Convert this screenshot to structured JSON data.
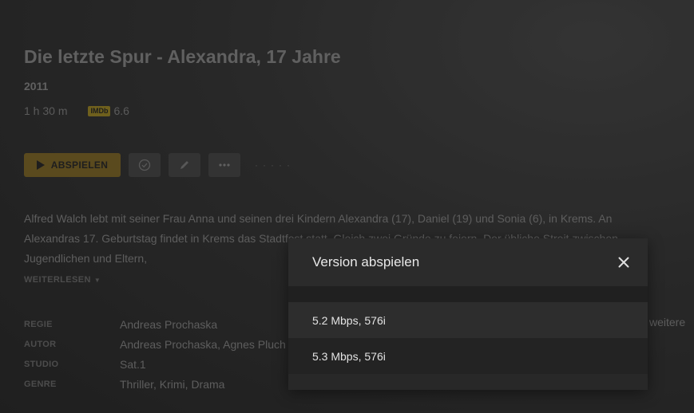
{
  "movie": {
    "title": "Die letzte Spur - Alexandra, 17 Jahre",
    "year": "2011",
    "duration": "1 h 30 m",
    "imdb_label": "IMDb",
    "imdb_rating": "6.6"
  },
  "actions": {
    "play_label": "ABSPIELEN",
    "watched_icon": "check-circle-icon",
    "edit_icon": "pencil-icon",
    "more_icon": "ellipsis-icon"
  },
  "description": {
    "text": "Alfred Walch lebt mit seiner Frau Anna und seinen drei Kindern Alexandra (17), Daniel (19) und Sonia (6), in Krems. An Alexandras 17. Geburtstag findet in Krems das Stadtfest statt. Gleich zwei Gründe zu feiern. Der übliche Streit zwischen Jugendlichen und Eltern,",
    "read_more": "WEITERLESEN"
  },
  "credits": [
    {
      "label": "REGIE",
      "value": "Andreas Prochaska"
    },
    {
      "label": "AUTOR",
      "value": "Andreas Prochaska, Agnes Pluch"
    },
    {
      "label": "STUDIO",
      "value": "Sat.1"
    },
    {
      "label": "GENRE",
      "value": "Thriller, Krimi, Drama"
    }
  ],
  "more_right": "weitere",
  "modal": {
    "title": "Version abspielen",
    "close_icon": "close-icon",
    "versions": [
      {
        "label": "5.2 Mbps, 576i"
      },
      {
        "label": "5.3 Mbps, 576i"
      }
    ]
  },
  "colors": {
    "accent": "#826a2c",
    "modal_bg": "#282828"
  }
}
